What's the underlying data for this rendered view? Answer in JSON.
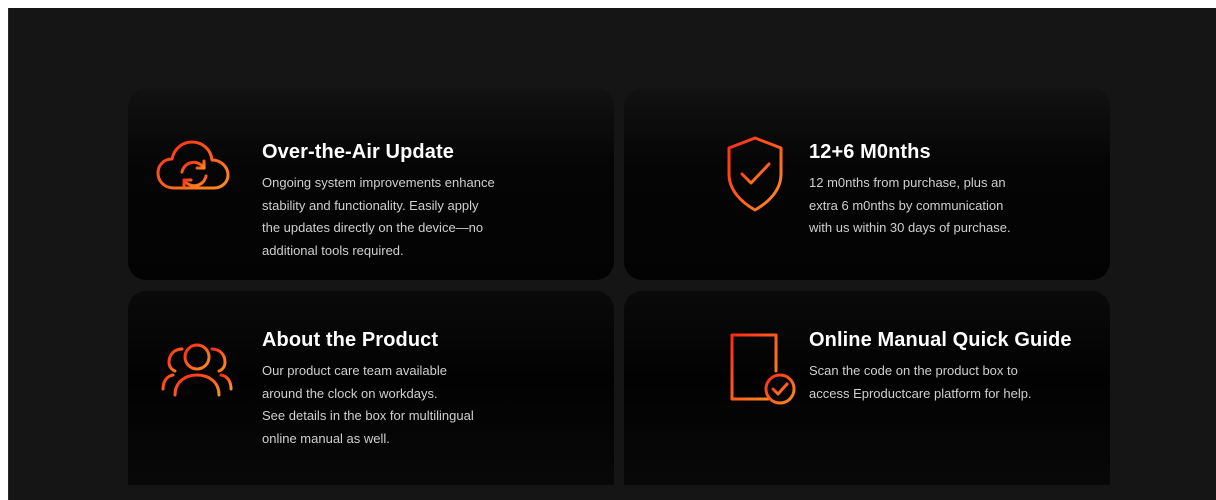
{
  "colors": {
    "accent_start": "#ff2a1a",
    "accent_end": "#ff8a1a",
    "card_bg": "#050505",
    "page_bg": "#151515"
  },
  "cards": [
    {
      "icon": "cloud-sync-icon",
      "title": "Over-the-Air Update",
      "desc": "Ongoing system improvements enhance\nstability and functionality. Easily apply\nthe updates directly on the device—no\nadditional tools required."
    },
    {
      "icon": "shield-check-icon",
      "title": "12+6 M0nths",
      "desc": "12 m0nths from purchase, plus an\nextra 6 m0nths by communication\nwith us within 30 days of purchase."
    },
    {
      "icon": "users-icon",
      "title": "About the Product",
      "desc": "Our product care team available\naround the clock on workdays.\nSee details in the box for multilingual\nonline manual as well."
    },
    {
      "icon": "document-check-icon",
      "title": "Online Manual Quick Guide",
      "desc": "Scan the code on the product box to\naccess Eproductcare platform for help."
    }
  ]
}
